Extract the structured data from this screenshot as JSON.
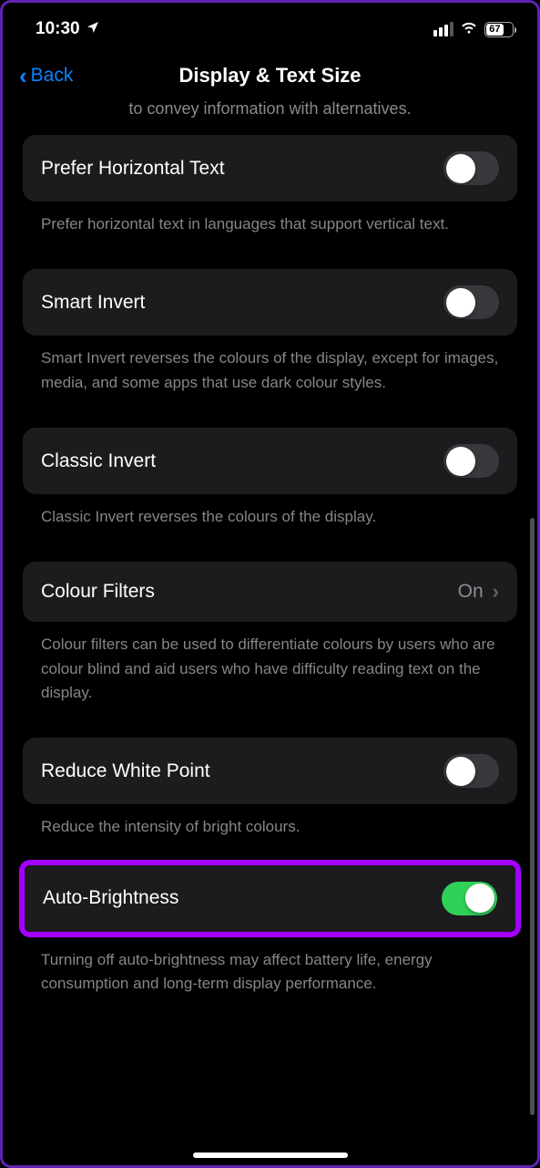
{
  "statusBar": {
    "time": "10:30",
    "battery": "67"
  },
  "nav": {
    "back": "Back",
    "title": "Display & Text Size"
  },
  "truncated": "to convey information with alternatives.",
  "rows": {
    "preferHorizontal": {
      "label": "Prefer Horizontal Text",
      "footer": "Prefer horizontal text in languages that support vertical text."
    },
    "smartInvert": {
      "label": "Smart Invert",
      "footer": "Smart Invert reverses the colours of the display, except for images, media, and some apps that use dark colour styles."
    },
    "classicInvert": {
      "label": "Classic Invert",
      "footer": "Classic Invert reverses the colours of the display."
    },
    "colourFilters": {
      "label": "Colour Filters",
      "value": "On",
      "footer": "Colour filters can be used to differentiate colours by users who are colour blind and aid users who have difficulty reading text on the display."
    },
    "reduceWhitePoint": {
      "label": "Reduce White Point",
      "footer": "Reduce the intensity of bright colours."
    },
    "autoBrightness": {
      "label": "Auto-Brightness",
      "footer": "Turning off auto-brightness may affect battery life, energy consumption and long-term display performance."
    }
  }
}
